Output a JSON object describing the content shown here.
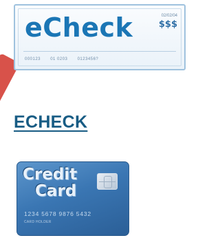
{
  "echeck_card": {
    "title": "eCheck",
    "date": "02/02/04",
    "amount": "$$$",
    "micr_numbers": [
      "000123",
      "01 0203",
      "0123456?"
    ]
  },
  "echeck_link": {
    "label": "ECHECK"
  },
  "credit_card": {
    "line1": "Credit",
    "line2": "Card",
    "number": "1234 5678 9876 5432",
    "holder": "CARD HOLDER"
  },
  "colors": {
    "link": "#185c84",
    "echeck_text": "#1b76b5",
    "card_blue": "#3a76b3",
    "accent_tab": "#d8524a"
  }
}
